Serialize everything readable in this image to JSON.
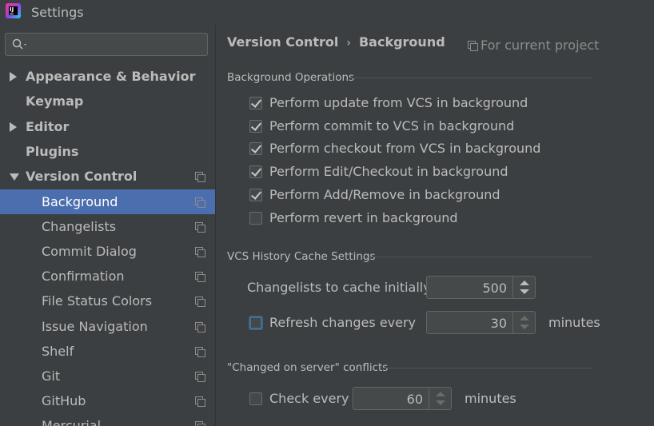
{
  "window": {
    "title": "Settings"
  },
  "search": {
    "placeholder": ""
  },
  "sidebar": {
    "items": [
      {
        "label": "Appearance & Behavior"
      },
      {
        "label": "Keymap"
      },
      {
        "label": "Editor"
      },
      {
        "label": "Plugins"
      },
      {
        "label": "Version Control"
      },
      {
        "label": "Background"
      },
      {
        "label": "Changelists"
      },
      {
        "label": "Commit Dialog"
      },
      {
        "label": "Confirmation"
      },
      {
        "label": "File Status Colors"
      },
      {
        "label": "Issue Navigation"
      },
      {
        "label": "Shelf"
      },
      {
        "label": "Git"
      },
      {
        "label": "GitHub"
      },
      {
        "label": "Mercurial"
      }
    ],
    "selected": "Background"
  },
  "main": {
    "breadcrumb": {
      "parent": "Version Control",
      "separator": "›",
      "current": "Background"
    },
    "scope_note": "For current project",
    "sections": {
      "background_ops": {
        "title": "Background Operations",
        "options": [
          {
            "label": "Perform update from VCS in background",
            "checked": true
          },
          {
            "label": "Perform commit to VCS in background",
            "checked": true
          },
          {
            "label": "Perform checkout from VCS in background",
            "checked": true
          },
          {
            "label": "Perform Edit/Checkout in background",
            "checked": true
          },
          {
            "label": "Perform Add/Remove in background",
            "checked": true
          },
          {
            "label": "Perform revert in background",
            "checked": false
          }
        ]
      },
      "history_cache": {
        "title": "VCS History Cache Settings",
        "changelists_label": "Changelists to cache initially:",
        "changelists_value": "500",
        "refresh_label": "Refresh changes every",
        "refresh_checked": false,
        "refresh_value": "30",
        "refresh_unit": "minutes"
      },
      "server_conflicts": {
        "title": "\"Changed on server\" conflicts",
        "check_label": "Check every",
        "check_checked": false,
        "check_value": "60",
        "check_unit": "minutes"
      }
    }
  },
  "colors": {
    "selection": "#4b6eaf",
    "background": "#3c3f41",
    "text": "#bbbbbb"
  }
}
